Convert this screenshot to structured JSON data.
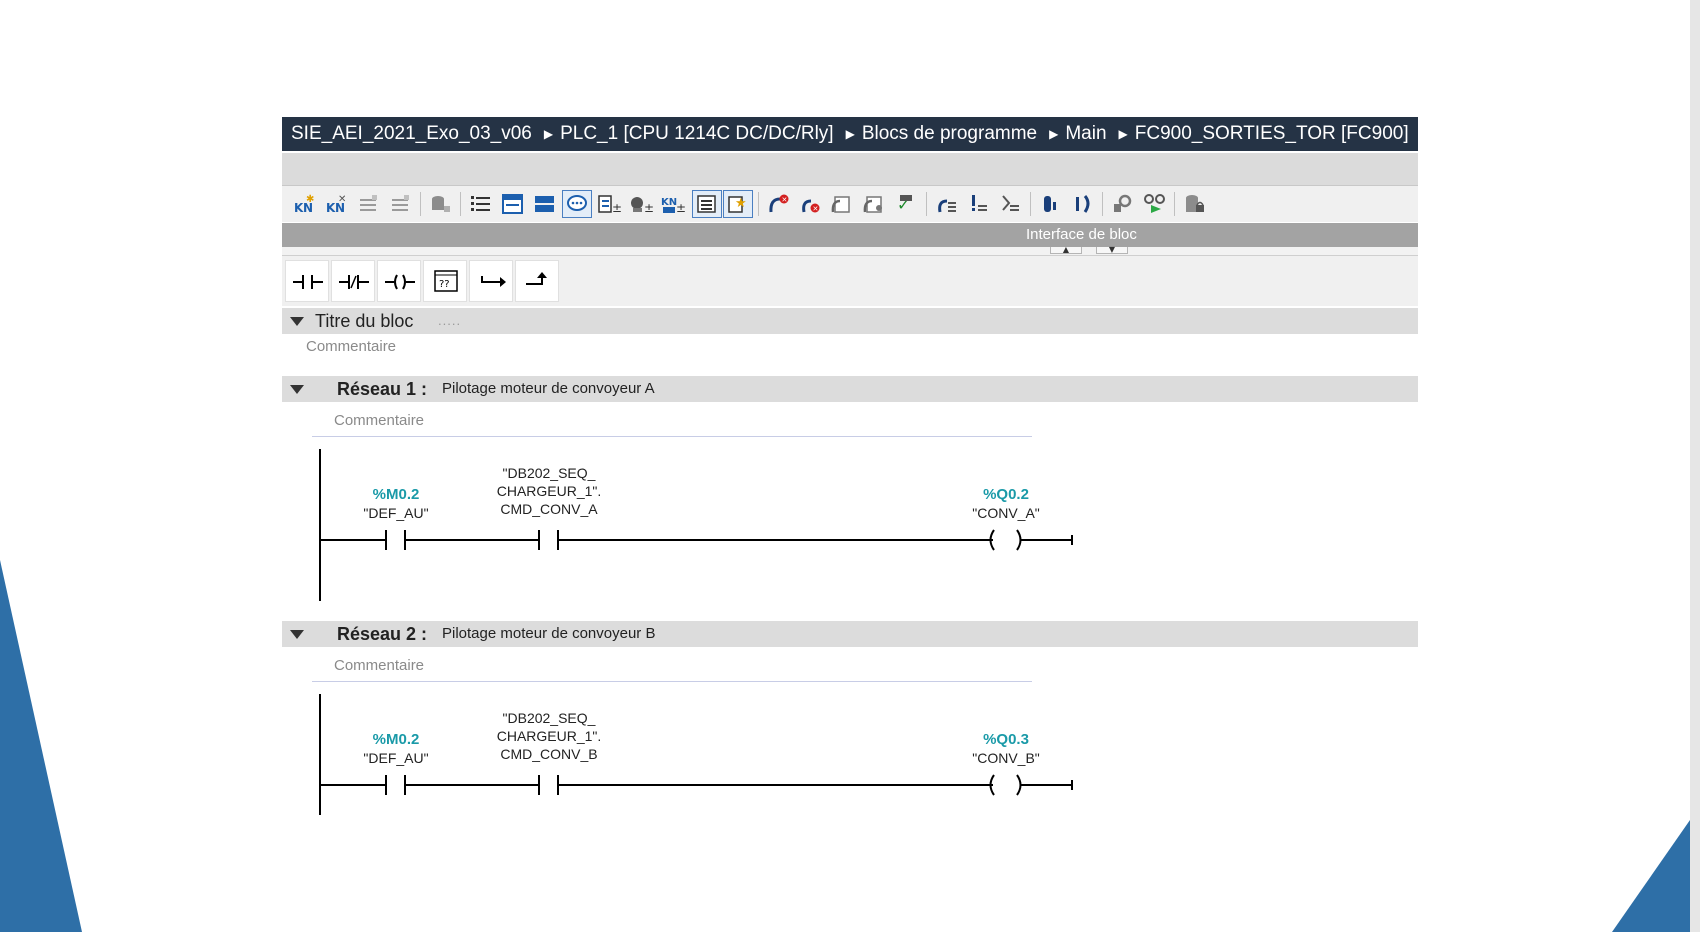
{
  "colors": {
    "breadcrumb_bg": "#253345",
    "address_teal": "#1a9aa8",
    "decoration_blue": "#2e6fa7",
    "header_grey": "#dcdcdc"
  },
  "breadcrumb": {
    "items": [
      "SIE_AEI_2021_Exo_03_v06",
      "PLC_1 [CPU 1214C DC/DC/Rly]",
      "Blocs de programme",
      "Main",
      "FC900_SORTIES_TOR [FC900]"
    ],
    "separator_icon": "triangle-right-icon"
  },
  "toolbar": {
    "icons": [
      "insert-network-icon",
      "delete-network-icon",
      "insert-row-icon",
      "add-row-icon",
      "db-icon",
      "absolute-operands-icon",
      "favorites-icon",
      "networks-icon",
      "comments-icon",
      "expand-networks-icon",
      "call-structure-icon",
      "collapse-networks-icon",
      "display-list-icon",
      "favorites-star-icon",
      "go-to-error-icon",
      "error-prev-icon",
      "error-next-icon",
      "monitor-icon",
      "check-block-icon",
      "jump-prev-icon",
      "jump-down-icon",
      "jump-next-icon",
      "watch-icon",
      "force-icon",
      "search-icon",
      "monitor-modify-icon",
      "protection-icon"
    ]
  },
  "interface_bar": {
    "label": "Interface de bloc"
  },
  "ladder_toolbar": {
    "icons": [
      "no-contact-icon",
      "nc-contact-icon",
      "coil-icon",
      "empty-box-icon",
      "open-branch-icon",
      "close-branch-icon"
    ],
    "empty_box_text": "??"
  },
  "block": {
    "title": "Titre du bloc",
    "title_dots": ".....",
    "comment": "Commentaire"
  },
  "networks": [
    {
      "label": "Réseau 1 :",
      "title": "Pilotage moteur de convoyeur A",
      "comment": "Commentaire",
      "contact1": {
        "address": "%M0.2",
        "symbol": "\"DEF_AU\""
      },
      "contact2": {
        "line1": "\"DB202_SEQ_",
        "line2": "CHARGEUR_1\".",
        "line3": "CMD_CONV_A"
      },
      "coil": {
        "address": "%Q0.2",
        "symbol": "\"CONV_A\""
      }
    },
    {
      "label": "Réseau 2 :",
      "title": "Pilotage moteur de convoyeur B",
      "comment": "Commentaire",
      "contact1": {
        "address": "%M0.2",
        "symbol": "\"DEF_AU\""
      },
      "contact2": {
        "line1": "\"DB202_SEQ_",
        "line2": "CHARGEUR_1\".",
        "line3": "CMD_CONV_B"
      },
      "coil": {
        "address": "%Q0.3",
        "symbol": "\"CONV_B\""
      }
    }
  ]
}
